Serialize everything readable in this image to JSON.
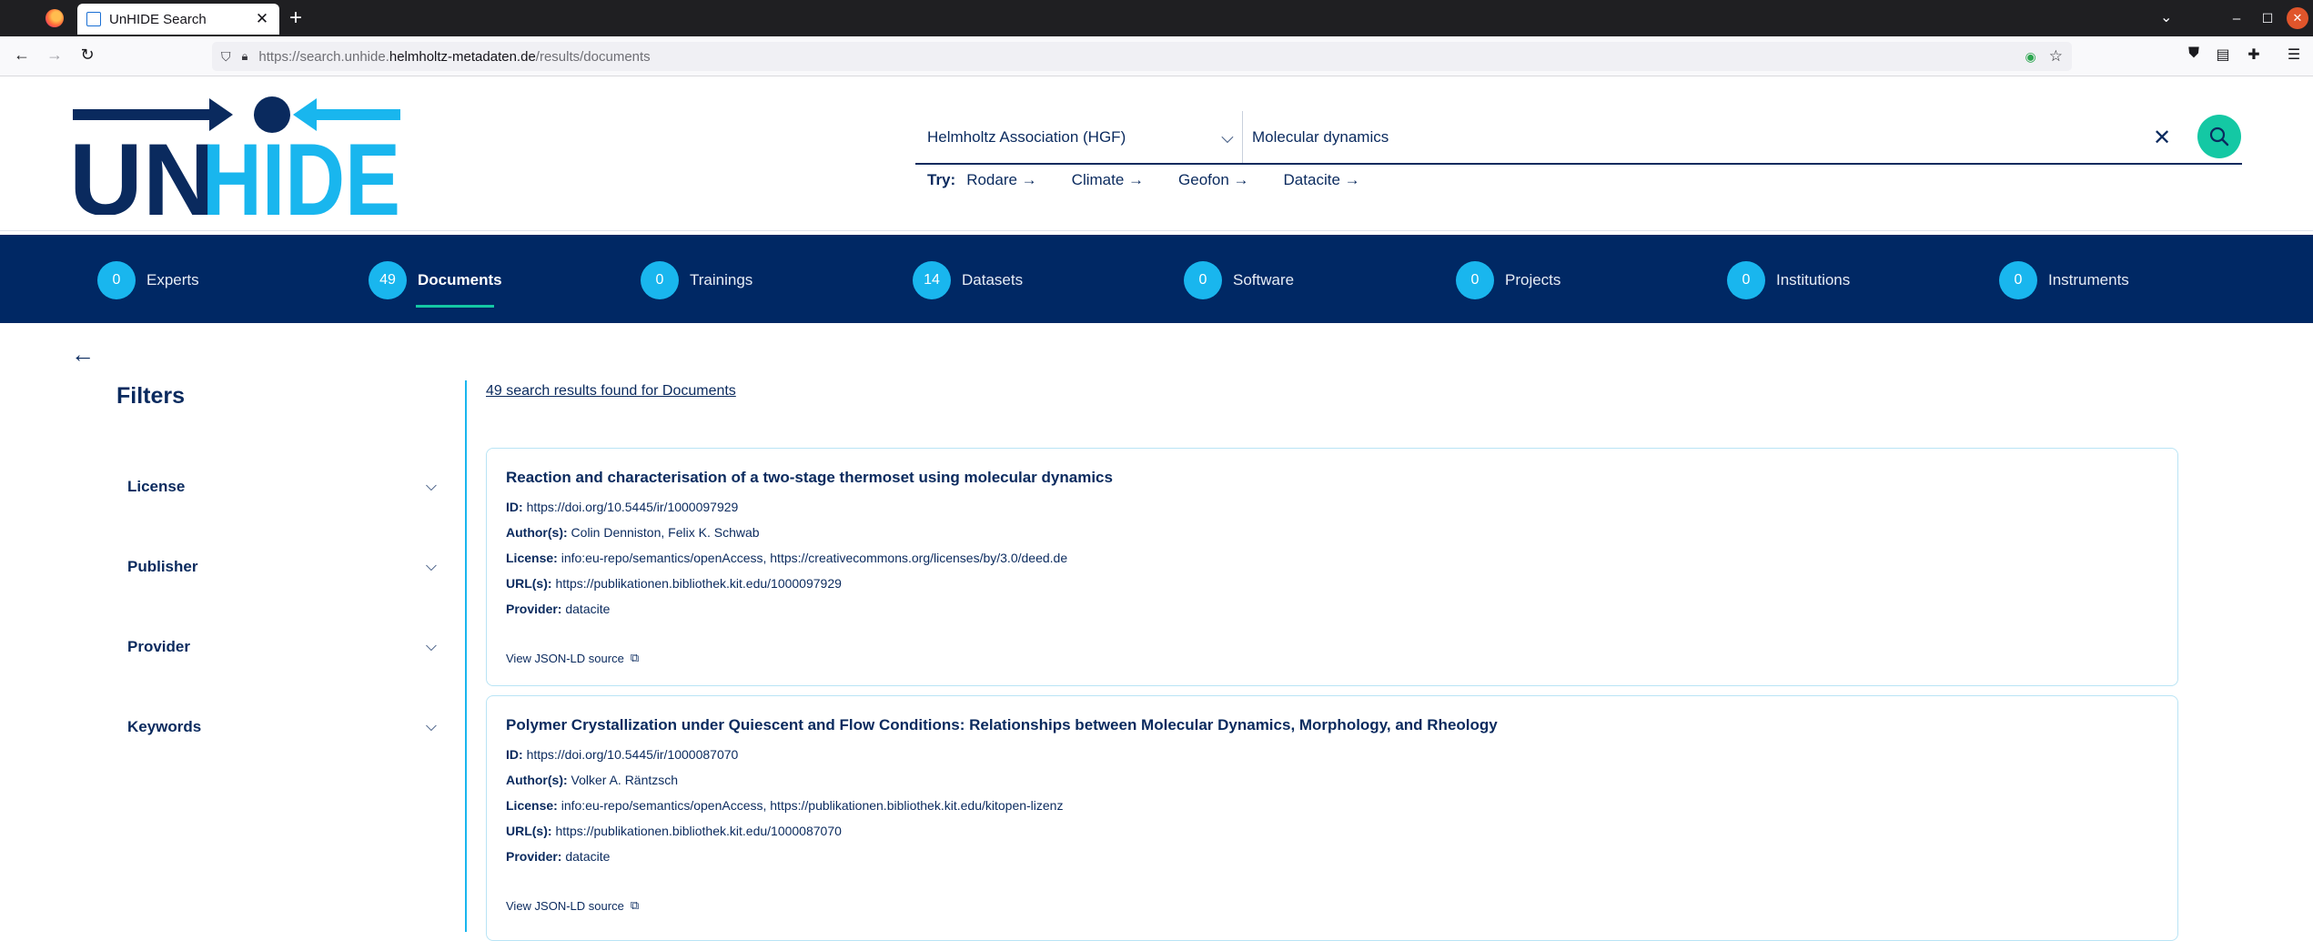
{
  "browser": {
    "tab_title": "UnHIDE Search",
    "tab_favicon": "UnHIDE",
    "url_prefix": "https://search.unhide.",
    "url_host": "helmholtz-metadaten.de",
    "url_path": "/results/documents"
  },
  "logo": {
    "text_un": "UN",
    "text_hide": "HIDE",
    "dark": "#0a2a5e",
    "light": "#19b6ee"
  },
  "search": {
    "scope": "Helmholtz Association (HGF)",
    "query": "Molecular dynamics",
    "try_label": "Try:",
    "suggestions": [
      "Rodare →",
      "Climate →",
      "Geofon →",
      "Datacite →"
    ]
  },
  "categories": [
    {
      "count": "0",
      "label": "Experts"
    },
    {
      "count": "49",
      "label": "Documents",
      "active": true
    },
    {
      "count": "0",
      "label": "Trainings"
    },
    {
      "count": "14",
      "label": "Datasets"
    },
    {
      "count": "0",
      "label": "Software"
    },
    {
      "count": "0",
      "label": "Projects"
    },
    {
      "count": "0",
      "label": "Institutions"
    },
    {
      "count": "0",
      "label": "Instruments"
    }
  ],
  "filters": {
    "title": "Filters",
    "groups": [
      "License",
      "Publisher",
      "Provider",
      "Keywords"
    ]
  },
  "results": {
    "summary": "49 search results found for Documents",
    "labels": {
      "id": "ID:",
      "authors": "Author(s):",
      "license": "License:",
      "urls": "URL(s):",
      "provider": "Provider:"
    },
    "json_link": "View JSON-LD source",
    "items": [
      {
        "title": "Reaction and characterisation of a two-stage thermoset using molecular dynamics",
        "id": "https://doi.org/10.5445/ir/1000097929",
        "authors": "Colin Denniston, Felix K. Schwab",
        "license": "info:eu-repo/semantics/openAccess, https://creativecommons.org/licenses/by/3.0/deed.de",
        "urls": "https://publikationen.bibliothek.kit.edu/1000097929",
        "provider": "datacite"
      },
      {
        "title": "Polymer Crystallization under Quiescent and Flow Conditions: Relationships between Molecular Dynamics, Morphology, and Rheology",
        "id": "https://doi.org/10.5445/ir/1000087070",
        "authors": "Volker A. Räntzsch",
        "license": "info:eu-repo/semantics/openAccess, https://publikationen.bibliothek.kit.edu/kitopen-lizenz",
        "urls": "https://publikationen.bibliothek.kit.edu/1000087070",
        "provider": "datacite"
      }
    ]
  },
  "colors": {
    "brand_navy": "#002864",
    "accent_cyan": "#19b6ee",
    "accent_green": "#14c8a4"
  }
}
